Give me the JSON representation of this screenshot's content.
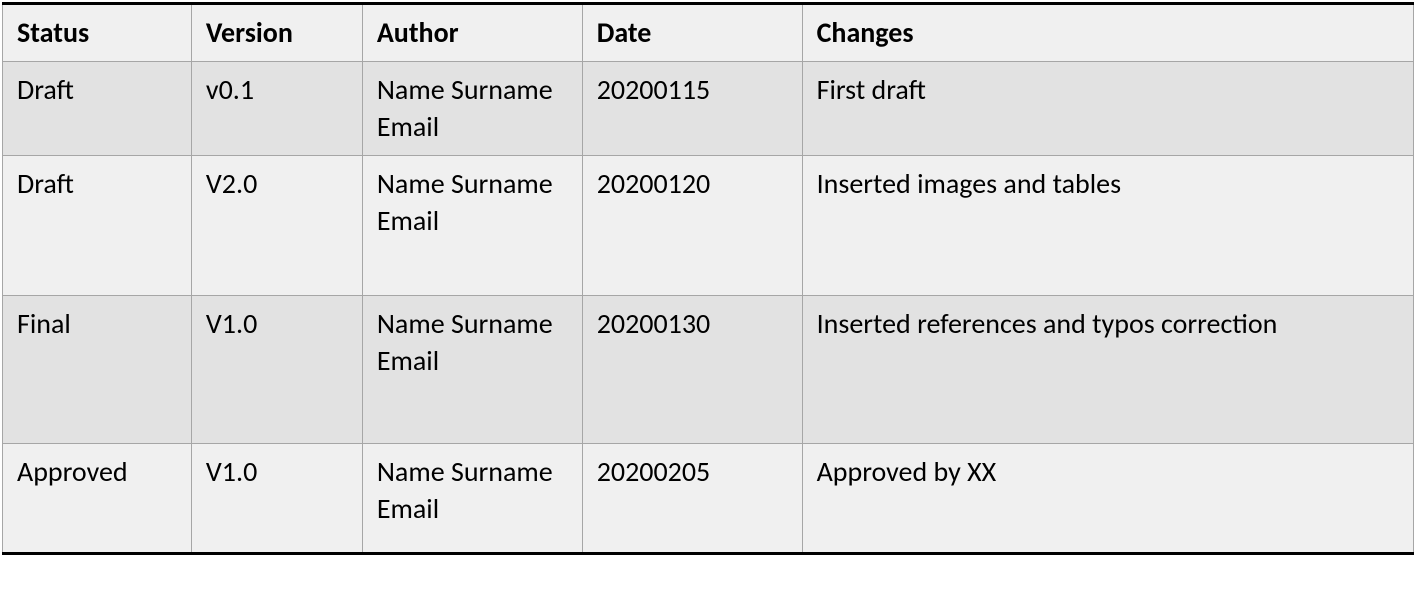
{
  "table": {
    "headers": {
      "status": "Status",
      "version": "Version",
      "author": "Author",
      "date": "Date",
      "changes": "Changes"
    },
    "rows": [
      {
        "status": "Draft",
        "version": "v0.1",
        "author_line1": "Name Surname",
        "author_line2": "Email",
        "date": "20200115",
        "changes": "First draft"
      },
      {
        "status": "Draft",
        "version": "V2.0",
        "author_line1": "Name Surname",
        "author_line2": "Email",
        "date": "20200120",
        "changes": "Inserted images and tables"
      },
      {
        "status": "Final",
        "version": "V1.0",
        "author_line1": "Name Surname",
        "author_line2": "Email",
        "date": "20200130",
        "changes": "Inserted references and typos correction"
      },
      {
        "status": "Approved",
        "version": "V1.0",
        "author_line1": "Name Surname",
        "author_line2": "Email",
        "date": "20200205",
        "changes": "Approved by XX"
      }
    ]
  }
}
